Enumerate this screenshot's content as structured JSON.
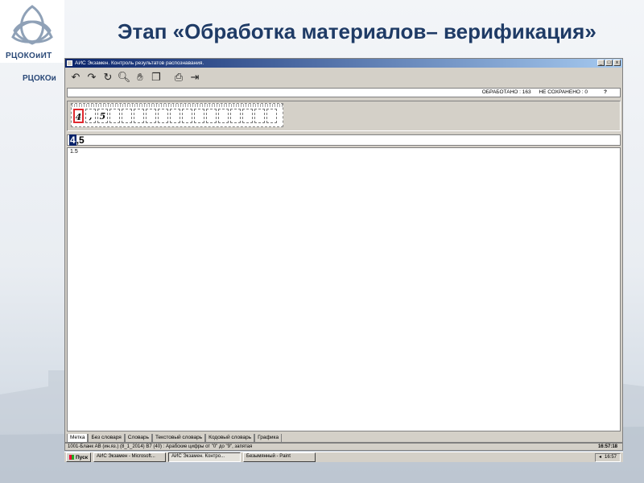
{
  "slide": {
    "title": "Этап «Обработка материалов– верификация»",
    "logo_text": "РЦОКОиИТ",
    "logo_text_repeat": "РЦОКОи"
  },
  "window": {
    "title": "АИС Экзамен. Контроль результатов распознавания.",
    "buttons": [
      "_",
      "□",
      "x"
    ]
  },
  "toolbar": {
    "icons": [
      "undo-icon",
      "redo-icon",
      "refresh-icon",
      "search-icon",
      "hand-icon",
      "copy-icon",
      "export-icon",
      "exit-icon"
    ]
  },
  "info": {
    "processed": "ОБРАБОТАНО : 163",
    "unsaved": "НЕ СОХРАНЕНО : 0",
    "help": "?"
  },
  "recognition": {
    "chars": [
      "4",
      ",",
      "5",
      "",
      "",
      "",
      "",
      "",
      "",
      "",
      "",
      "",
      "",
      "",
      "",
      "",
      ""
    ]
  },
  "answer": {
    "selected": "4",
    "rest": ",5"
  },
  "text_field": {
    "value": "1.5"
  },
  "tabs": [
    "Метка",
    "Без словаря",
    "Словарь",
    "Текстовый словарь",
    "Кодовый словарь",
    "Графика"
  ],
  "status": {
    "text": "1001-Бланк АВ (ин.яз.) (8_1_2014)   В7 (40) : Арабские цифры от \"0\" до \"9\", запятая",
    "time": "16:57:18"
  },
  "taskbar": {
    "start": "Пуск",
    "items": [
      "АИС Экзамен - Microsoft...",
      "АИС Экзамен. Контро...",
      "Безымянный - Paint"
    ],
    "tray_time": "16:57"
  },
  "colors": {
    "title_color": "#1f3b66",
    "selection": "#0a246a",
    "active_cell": "#e0282e"
  }
}
